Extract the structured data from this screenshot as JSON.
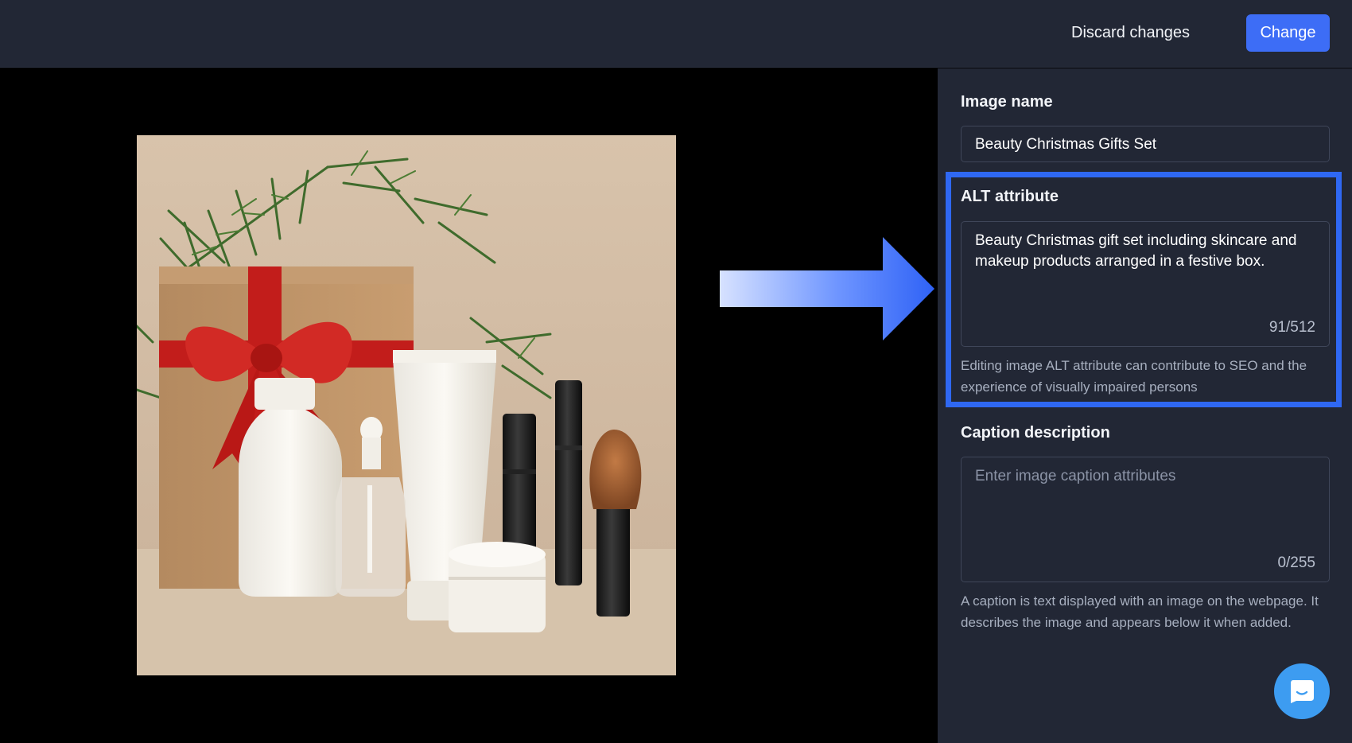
{
  "toolbar": {
    "discard_label": "Discard changes",
    "change_label": "Change"
  },
  "preview": {
    "image_icon": "beauty-christmas-gift-set-photo",
    "arrow_icon": "arrow-right-icon"
  },
  "panel": {
    "image_name": {
      "label": "Image name",
      "value": "Beauty Christmas Gifts Set"
    },
    "alt": {
      "label": "ALT attribute",
      "value": "Beauty Christmas gift set including skincare and makeup products arranged in a festive box.",
      "counter": "91/512",
      "help": "Editing image ALT attribute can contribute to SEO and the experience of visually impaired persons"
    },
    "caption": {
      "label": "Caption description",
      "placeholder": "Enter image caption attributes",
      "counter": "0/255",
      "help": "A caption is text displayed with an image on the webpage. It describes the image and appears below it when added."
    }
  },
  "chat": {
    "icon": "chat-icon"
  },
  "colors": {
    "accent": "#3d6df6",
    "highlight": "#2f68f3",
    "panel_bg": "#222735",
    "chat": "#3d9cf1"
  }
}
